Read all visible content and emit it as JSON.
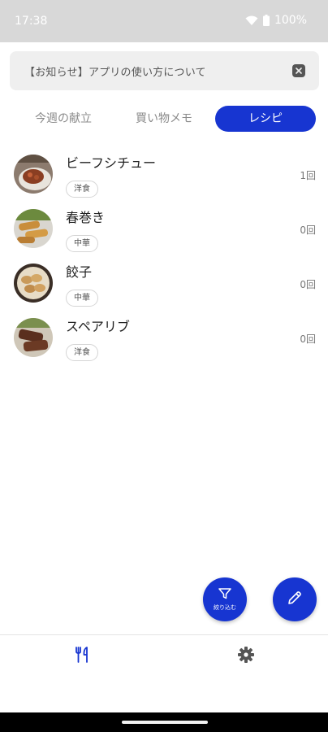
{
  "status_bar": {
    "time": "17:38",
    "battery": "100%",
    "icons": [
      "wifi-icon",
      "battery-icon"
    ]
  },
  "notice": {
    "text": "【お知らせ】アプリの使い方について",
    "close_icon": "close-icon"
  },
  "tabs": [
    {
      "label": "今週の献立",
      "active": false
    },
    {
      "label": "買い物メモ",
      "active": false
    },
    {
      "label": "レシピ",
      "active": true
    }
  ],
  "recipes": [
    {
      "name": "ビーフシチュー",
      "tag": "洋食",
      "count": "1回",
      "image_icon": "beef-stew-photo"
    },
    {
      "name": "春巻き",
      "tag": "中華",
      "count": "0回",
      "image_icon": "spring-rolls-photo"
    },
    {
      "name": "餃子",
      "tag": "中華",
      "count": "0回",
      "image_icon": "gyoza-photo"
    },
    {
      "name": "スペアリブ",
      "tag": "洋食",
      "count": "0回",
      "image_icon": "spare-ribs-photo"
    }
  ],
  "fab": {
    "filter_label": "絞り込む",
    "filter_icon": "filter-icon",
    "edit_icon": "pencil-icon"
  },
  "bottom_nav": {
    "items": [
      "utensils-icon",
      "gear-icon"
    ]
  },
  "colors": {
    "accent": "#1735d1",
    "status_bar": "#d8d8d8",
    "notice_bg": "#efefef"
  }
}
